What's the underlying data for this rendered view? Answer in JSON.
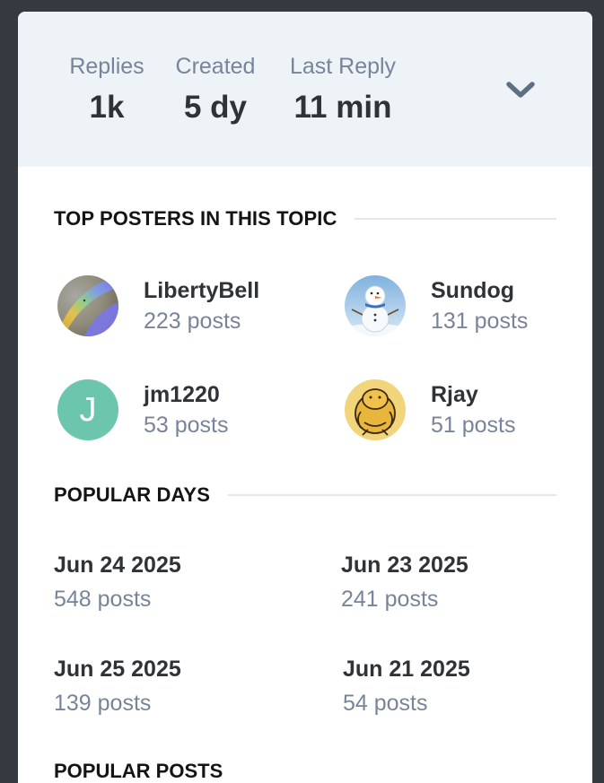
{
  "summary": {
    "stats": [
      {
        "label": "Replies",
        "value": "1k"
      },
      {
        "label": "Created",
        "value": "5 dy"
      },
      {
        "label": "Last Reply",
        "value": "11 min"
      }
    ],
    "expand_icon": "chevron-down-icon"
  },
  "top_posters": {
    "title": "TOP POSTERS IN THIS TOPIC",
    "users": [
      {
        "name": "LibertyBell",
        "posts": "223 posts",
        "avatar": "rainbow-photo"
      },
      {
        "name": "Sundog",
        "posts": "131 posts",
        "avatar": "snowman-photo"
      },
      {
        "name": "jm1220",
        "posts": "53 posts",
        "avatar_letter": "J",
        "avatar_color": "#6cc6ad"
      },
      {
        "name": "Rjay",
        "posts": "51 posts",
        "avatar": "cartoon-bear-drawing"
      }
    ]
  },
  "popular_days": {
    "title": "POPULAR DAYS",
    "days": [
      {
        "date": "Jun 24 2025",
        "posts": "548 posts"
      },
      {
        "date": "Jun 23 2025",
        "posts": "241 posts"
      },
      {
        "date": "Jun 25 2025",
        "posts": "139 posts"
      },
      {
        "date": "Jun 21 2025",
        "posts": "54 posts"
      }
    ]
  },
  "popular_posts": {
    "title": "POPULAR POSTS"
  },
  "colors": {
    "page_bg": "#343a40",
    "summary_bg": "#eef3f8",
    "muted_text": "#77849a",
    "strong_text": "#2f3337"
  }
}
